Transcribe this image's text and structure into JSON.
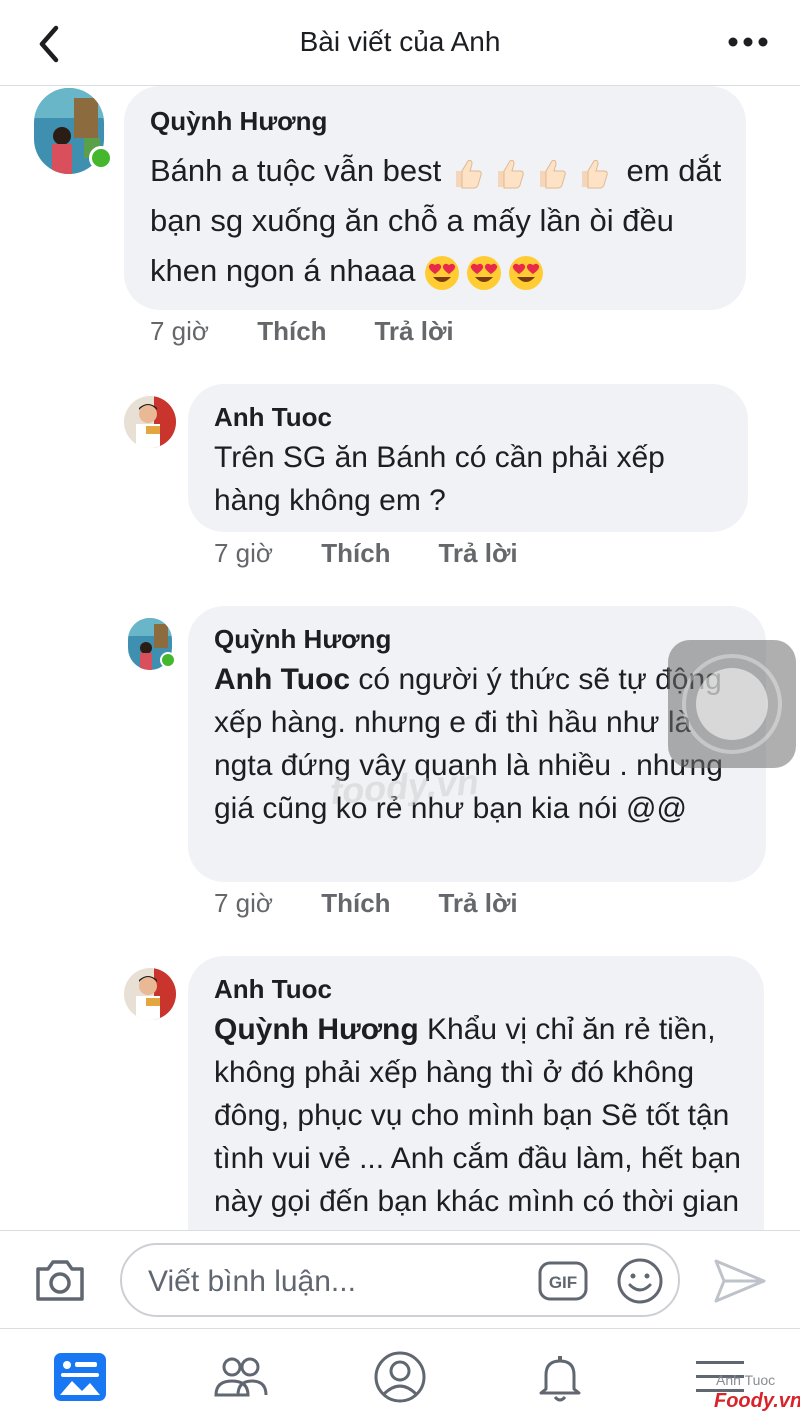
{
  "header": {
    "title": "Bài viết của Anh"
  },
  "comments": [
    {
      "author": "Quỳnh Hương",
      "text_1": "Bánh a tuộc vẫn best",
      "text_2": "em dắt bạn sg xuống ăn chỗ a mấy lần òi đều khen ngon á nhaaa",
      "time": "7 giờ",
      "like": "Thích",
      "reply": "Trả lời"
    },
    {
      "author": "Anh Tuoc",
      "text": "Trên SG ăn Bánh có cần phải xếp hàng không em ?",
      "time": "7 giờ",
      "like": "Thích",
      "reply": "Trả lời"
    },
    {
      "author": "Quỳnh Hương",
      "mention": "Anh Tuoc",
      "text": " có người ý thức sẽ tự động xếp hàng. nhưng e đi thì hầu như là ngta đứng vây quanh là nhiều . nhưng giá cũng ko rẻ như bạn kia nói @@",
      "time": "7 giờ",
      "like": "Thích",
      "reply": "Trả lời"
    },
    {
      "author": "Anh Tuoc",
      "mention": "Quỳnh Hương",
      "text": "  Khẩu vị chỉ ăn rẻ tiền, không phải xếp hàng thì ở đó không đông, phục vụ cho mình bạn Sẽ tốt tận tình vui vẻ ... Anh cắm đầu làm, hết bạn này gọi đến bạn khác mình có thời gian nói"
    }
  ],
  "watermark": "foody.vn",
  "composer": {
    "placeholder": "Viết bình luận...",
    "gif_label": "GIF"
  },
  "tabbar": {
    "active": "feed",
    "credit_name": "Anh Tuoc",
    "credit_brand": "Foody.vn"
  },
  "colors": {
    "bubble": "#f0f2f5",
    "active_tab": "#1877f2",
    "online": "#44b72d",
    "meta": "#65676b"
  },
  "icons": [
    "back-chevron-icon",
    "more-dots-icon",
    "camera-icon",
    "gif-icon",
    "smiley-icon",
    "send-icon",
    "news-feed-icon",
    "friends-icon",
    "profile-icon",
    "bell-icon",
    "menu-icon",
    "thumbs-up-emoji",
    "heart-eyes-emoji"
  ]
}
